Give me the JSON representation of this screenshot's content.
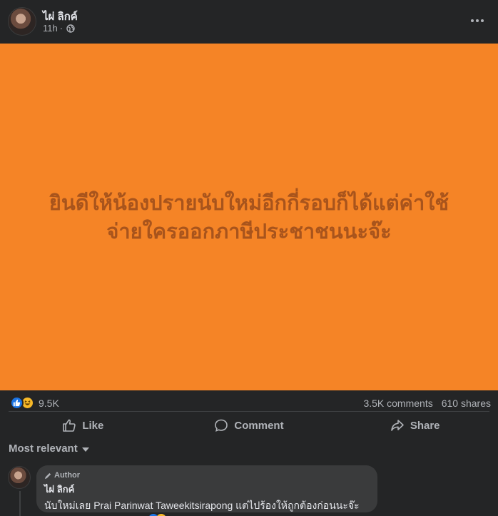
{
  "post": {
    "author": "ไผ่ ลิกค์",
    "time": "11h",
    "time_separator": "·",
    "image_text_line1": "ยินดีให้น้องปรายนับใหม่อีกกี่รอบก็ได้แต่ค่าใช้",
    "image_text_line2": "จ่ายใครออกภาษีประชาชนนะจ๊ะ",
    "image_bg_color": "#f58426",
    "reaction_count": "9.5K",
    "comments": "3.5K comments",
    "shares": "610 shares"
  },
  "actions": {
    "like": "Like",
    "comment": "Comment",
    "share": "Share"
  },
  "sort": {
    "label": "Most relevant"
  },
  "comment": {
    "badge": "Author",
    "name": "ไผ่ ลิกค์",
    "text": "นับใหม่เลย Prai Parinwat Taweekitsirapong แต่ไปร้องให้ถูกต้องก่อนนะจ๊ะ"
  },
  "icons": {
    "globe": "globe-icon",
    "more": "more-icon",
    "like": "like-icon",
    "comment": "comment-icon",
    "share": "share-icon",
    "reaction_like": "like-reaction-icon",
    "reaction_haha": "haha-reaction-icon",
    "pen": "pen-icon",
    "caret": "caret-down-icon"
  },
  "colors": {
    "accent": "#1b74e4",
    "haha": "#f7b928",
    "image_text": "#a8541c"
  }
}
